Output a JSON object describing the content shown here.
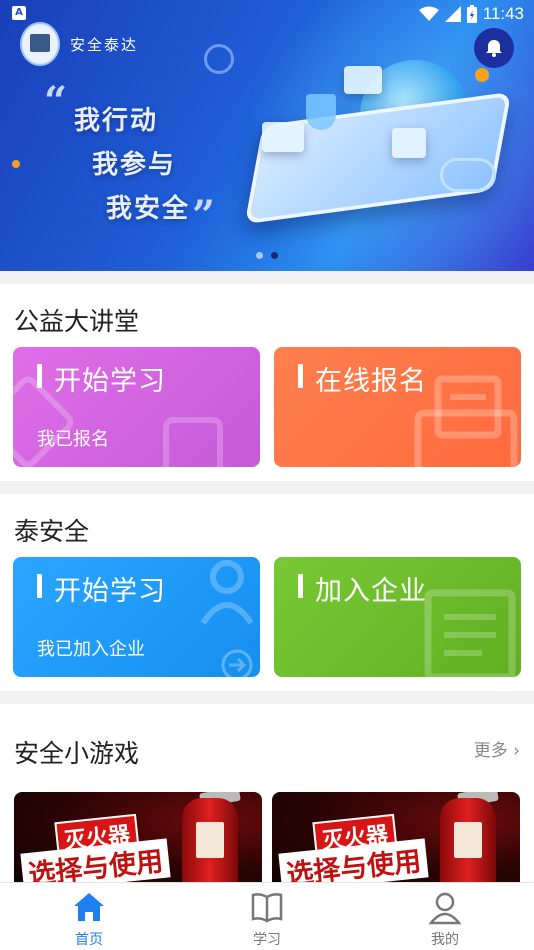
{
  "status_bar": {
    "time": "11:43",
    "left_badge": "A"
  },
  "header": {
    "app_name": "安全泰达"
  },
  "banner": {
    "slogan_lines": [
      "我行动",
      "我参与",
      "我安全"
    ],
    "slide_count": 2,
    "active_slide": 2
  },
  "sections": [
    {
      "title": "公益大讲堂",
      "tiles": [
        {
          "title": "开始学习",
          "subtitle": "我已报名",
          "color": "#d466e2"
        },
        {
          "title": "在线报名",
          "subtitle": "",
          "color": "#ff7448"
        }
      ]
    },
    {
      "title": "泰安全",
      "tiles": [
        {
          "title": "开始学习",
          "subtitle": "我已加入企业",
          "color": "#1f9cff"
        },
        {
          "title": "加入企业",
          "subtitle": "",
          "color": "#6fc12a"
        }
      ]
    }
  ],
  "games": {
    "title": "安全小游戏",
    "more_label": "更多",
    "items": [
      {
        "line1": "灭火器",
        "line2": "选择与使用"
      },
      {
        "line1": "灭火器",
        "line2": "选择与使用"
      }
    ]
  },
  "bottom_nav": [
    {
      "label": "首页",
      "icon": "home-icon",
      "active": true
    },
    {
      "label": "学习",
      "icon": "book-icon",
      "active": false
    },
    {
      "label": "我的",
      "icon": "user-icon",
      "active": false
    }
  ],
  "colors": {
    "accent": "#1e7ff0"
  }
}
